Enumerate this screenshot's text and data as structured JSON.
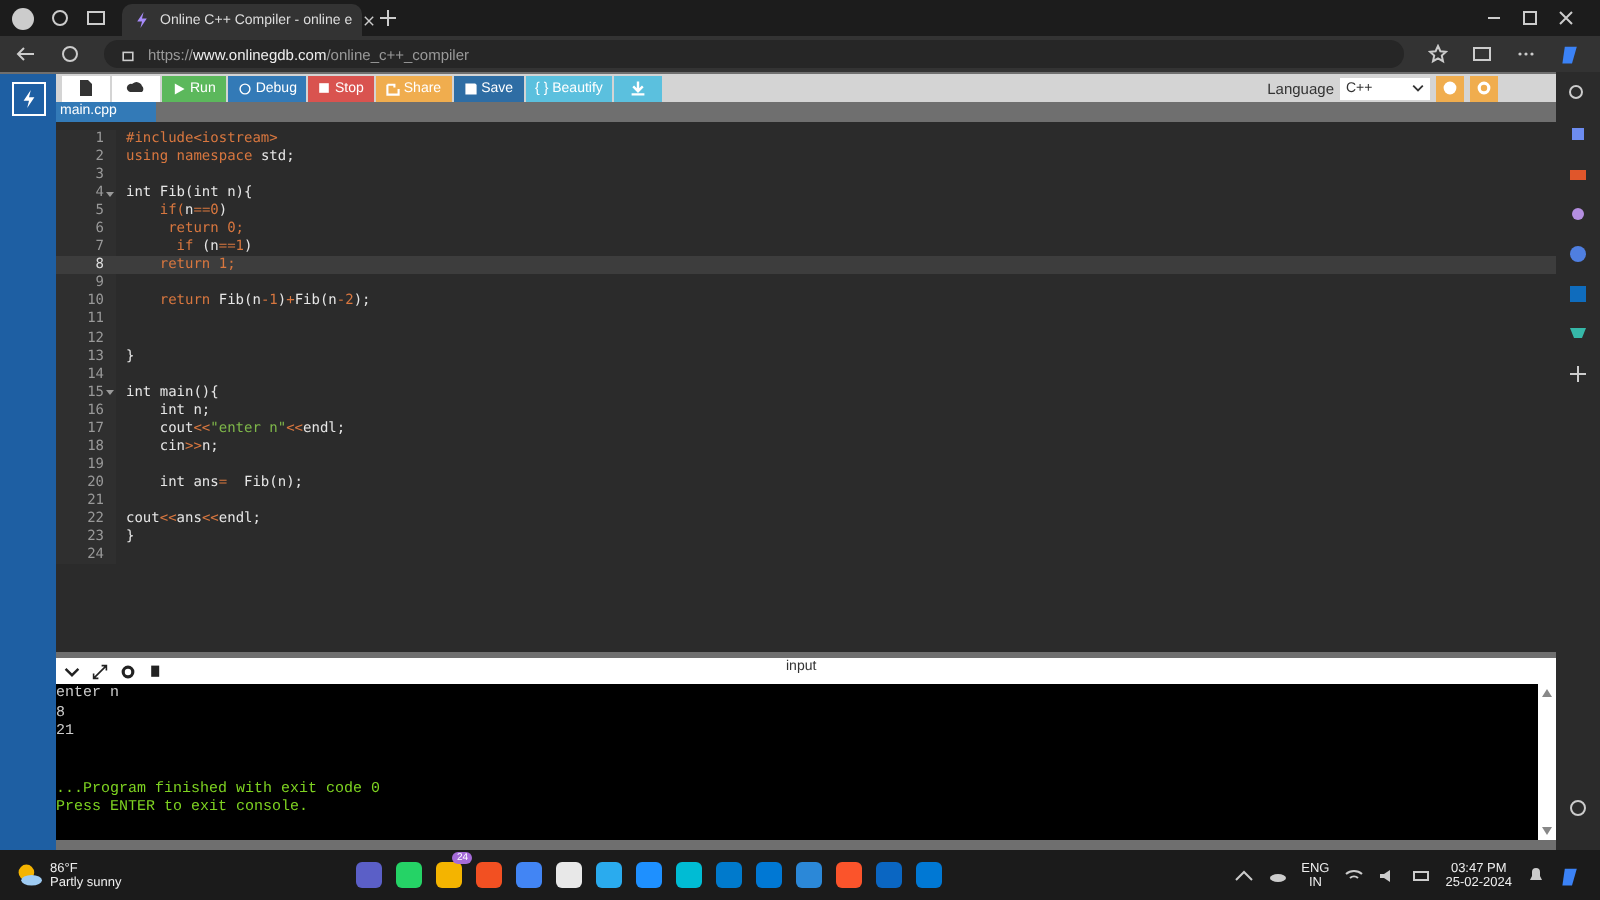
{
  "browser": {
    "tab_title": "Online C++ Compiler - online e",
    "url": "https://**www.onlinegdb.com**/online_c++_compiler"
  },
  "toolbar": {
    "buttons": [
      {
        "kind": "icon",
        "color": "#ffffff"
      },
      {
        "kind": "icon",
        "color": "#ffffff"
      },
      {
        "kind": "labeled",
        "label": "Run",
        "color": "#5cb85c"
      },
      {
        "kind": "labeled",
        "label": "Debug",
        "color": "#337ab7"
      },
      {
        "kind": "labeled",
        "label": "Stop",
        "color": "#d9534f"
      },
      {
        "kind": "labeled",
        "label": "Share",
        "color": "#f0ad4e"
      },
      {
        "kind": "labeled",
        "label": "Save",
        "color": "#2e6da4"
      },
      {
        "kind": "labeled",
        "label": "{ } Beautify",
        "color": "#5bc0de"
      },
      {
        "kind": "icon",
        "color": "#5bc0de"
      }
    ],
    "language_label": "Language",
    "language_value": "C++"
  },
  "file_tab": "main.cpp",
  "code_lines": [
    {
      "number": "1",
      "active": false,
      "foldable": false,
      "tokens": [
        {
          "text": "#include<iostream>",
          "kind": "keyword"
        }
      ]
    },
    {
      "number": "2",
      "active": false,
      "foldable": false,
      "tokens": [
        {
          "text": "using namespace ",
          "kind": "keyword"
        },
        {
          "text": "std;",
          "kind": "plain"
        }
      ]
    },
    {
      "number": "3",
      "active": false,
      "foldable": false
    },
    {
      "number": "4",
      "active": false,
      "foldable": true,
      "tokens": [
        {
          "text": "int Fib(int n){",
          "kind": "plain"
        }
      ]
    },
    {
      "number": "5",
      "active": false,
      "foldable": false,
      "tokens": [
        {
          "text": "    if(",
          "kind": "keyword"
        },
        {
          "text": "n",
          "kind": "plain"
        },
        {
          "text": "==0",
          "kind": "keyword"
        },
        {
          "text": ")",
          "kind": "plain"
        }
      ]
    },
    {
      "number": "6",
      "active": false,
      "foldable": false,
      "tokens": [
        {
          "text": "     return 0;",
          "kind": "keyword"
        }
      ]
    },
    {
      "number": "7",
      "active": false,
      "foldable": false,
      "tokens": [
        {
          "text": "      if ",
          "kind": "keyword"
        },
        {
          "text": "(n",
          "kind": "plain"
        },
        {
          "text": "==1",
          "kind": "keyword"
        },
        {
          "text": ")",
          "kind": "plain"
        }
      ]
    },
    {
      "number": "8",
      "active": true,
      "foldable": false,
      "tokens": [
        {
          "text": "    return 1;",
          "kind": "keyword"
        }
      ]
    },
    {
      "number": "9",
      "active": false,
      "foldable": false
    },
    {
      "number": "10",
      "active": false,
      "foldable": false,
      "tokens": [
        {
          "text": "    return ",
          "kind": "keyword"
        },
        {
          "text": "Fib(n",
          "kind": "plain"
        },
        {
          "text": "-1",
          "kind": "keyword"
        },
        {
          "text": ")",
          "kind": "plain"
        },
        {
          "text": "+",
          "kind": "keyword"
        },
        {
          "text": "Fib(n",
          "kind": "plain"
        },
        {
          "text": "-2",
          "kind": "keyword"
        },
        {
          "text": ");",
          "kind": "plain"
        }
      ]
    },
    {
      "number": "11",
      "active": false,
      "foldable": false
    },
    {
      "number": "12",
      "active": false,
      "foldable": false
    },
    {
      "number": "13",
      "active": false,
      "foldable": false,
      "tokens": [
        {
          "text": "}",
          "kind": "plain"
        }
      ]
    },
    {
      "number": "14",
      "active": false,
      "foldable": false
    },
    {
      "number": "15",
      "active": false,
      "foldable": true,
      "tokens": [
        {
          "text": "int main(){",
          "kind": "plain"
        }
      ]
    },
    {
      "number": "16",
      "active": false,
      "foldable": false,
      "tokens": [
        {
          "text": "    int n;",
          "kind": "plain"
        }
      ]
    },
    {
      "number": "17",
      "active": false,
      "foldable": false,
      "tokens": [
        {
          "text": "    cout",
          "kind": "plain"
        },
        {
          "text": "<<",
          "kind": "keyword"
        },
        {
          "text": "\"enter n\"",
          "kind": "string"
        },
        {
          "text": "<<",
          "kind": "keyword"
        },
        {
          "text": "endl;",
          "kind": "plain"
        }
      ]
    },
    {
      "number": "18",
      "active": false,
      "foldable": false,
      "tokens": [
        {
          "text": "    cin",
          "kind": "plain"
        },
        {
          "text": ">>",
          "kind": "keyword"
        },
        {
          "text": "n;",
          "kind": "plain"
        }
      ]
    },
    {
      "number": "19",
      "active": false,
      "foldable": false
    },
    {
      "number": "20",
      "active": false,
      "foldable": false,
      "tokens": [
        {
          "text": "    int ans",
          "kind": "plain"
        },
        {
          "text": "=",
          "kind": "keyword"
        },
        {
          "text": "  Fib(n);",
          "kind": "plain"
        }
      ]
    },
    {
      "number": "21",
      "active": false,
      "foldable": false
    },
    {
      "number": "22",
      "active": false,
      "foldable": false,
      "tokens": [
        {
          "text": "cout",
          "kind": "plain"
        },
        {
          "text": "<<",
          "kind": "keyword"
        },
        {
          "text": "ans",
          "kind": "plain"
        },
        {
          "text": "<<",
          "kind": "keyword"
        },
        {
          "text": "endl;",
          "kind": "plain"
        }
      ]
    },
    {
      "number": "23",
      "active": false,
      "foldable": false,
      "tokens": [
        {
          "text": "}",
          "kind": "plain"
        }
      ]
    },
    {
      "number": "24",
      "active": false,
      "foldable": false
    }
  ],
  "console": {
    "title": "input",
    "lines": [
      {
        "text": "enter n",
        "kind": "output"
      },
      {
        "text": "8",
        "kind": "output"
      },
      {
        "text": "21",
        "kind": "output"
      },
      {
        "kind": "blank"
      },
      {
        "kind": "blank"
      },
      {
        "text": "...Program finished with exit code 0",
        "kind": "status"
      },
      {
        "text": "Press ENTER to exit console.",
        "kind": "status"
      }
    ]
  },
  "taskbar": {
    "weather_temp": "86°F",
    "weather_text": "Partly sunny",
    "chat_badge": "24",
    "language": "ENG",
    "region": "IN",
    "time": "03:47 PM",
    "date": "25-02-2024"
  }
}
